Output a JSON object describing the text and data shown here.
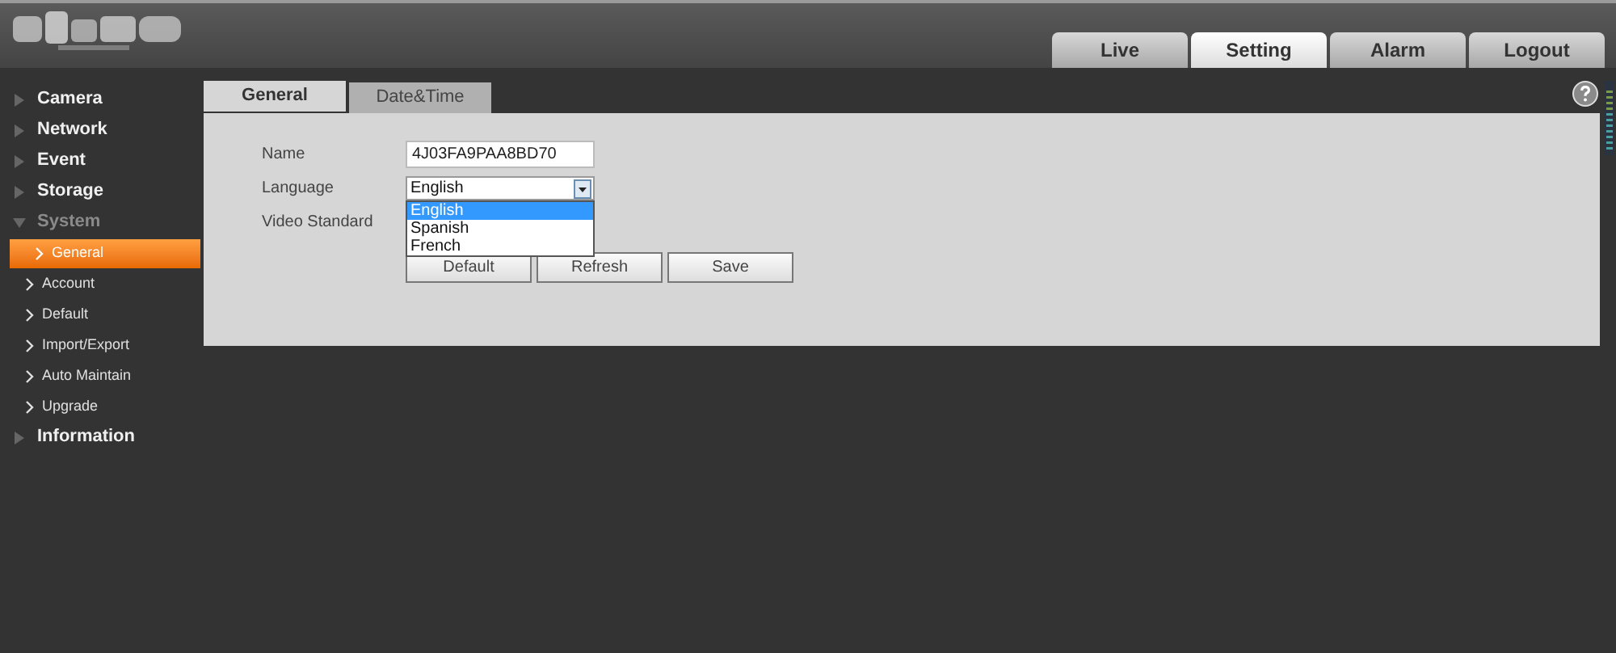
{
  "top_nav": [
    {
      "label": "Live",
      "selected": false
    },
    {
      "label": "Setting",
      "selected": true
    },
    {
      "label": "Alarm",
      "selected": false
    },
    {
      "label": "Logout",
      "selected": false
    }
  ],
  "sidebar": {
    "items": [
      {
        "label": "Camera",
        "expanded": false
      },
      {
        "label": "Network",
        "expanded": false
      },
      {
        "label": "Event",
        "expanded": false
      },
      {
        "label": "Storage",
        "expanded": false
      },
      {
        "label": "System",
        "expanded": true,
        "children": [
          {
            "label": "General",
            "selected": true
          },
          {
            "label": "Account",
            "selected": false
          },
          {
            "label": "Default",
            "selected": false
          },
          {
            "label": "Import/Export",
            "selected": false
          },
          {
            "label": "Auto Maintain",
            "selected": false
          },
          {
            "label": "Upgrade",
            "selected": false
          }
        ]
      },
      {
        "label": "Information",
        "expanded": false
      }
    ]
  },
  "tabs": [
    {
      "label": "General",
      "selected": true
    },
    {
      "label": "Date&Time",
      "selected": false
    }
  ],
  "form": {
    "name": {
      "label": "Name",
      "value": "4J03FA9PAA8BD70"
    },
    "language": {
      "label": "Language",
      "value": "English",
      "expanded": true,
      "options": [
        {
          "label": "English",
          "selected": true
        },
        {
          "label": "Spanish",
          "selected": false
        },
        {
          "label": "French",
          "selected": false
        }
      ]
    },
    "video_standard": {
      "label": "Video Standard"
    }
  },
  "buttons": [
    "Default",
    "Refresh",
    "Save"
  ]
}
